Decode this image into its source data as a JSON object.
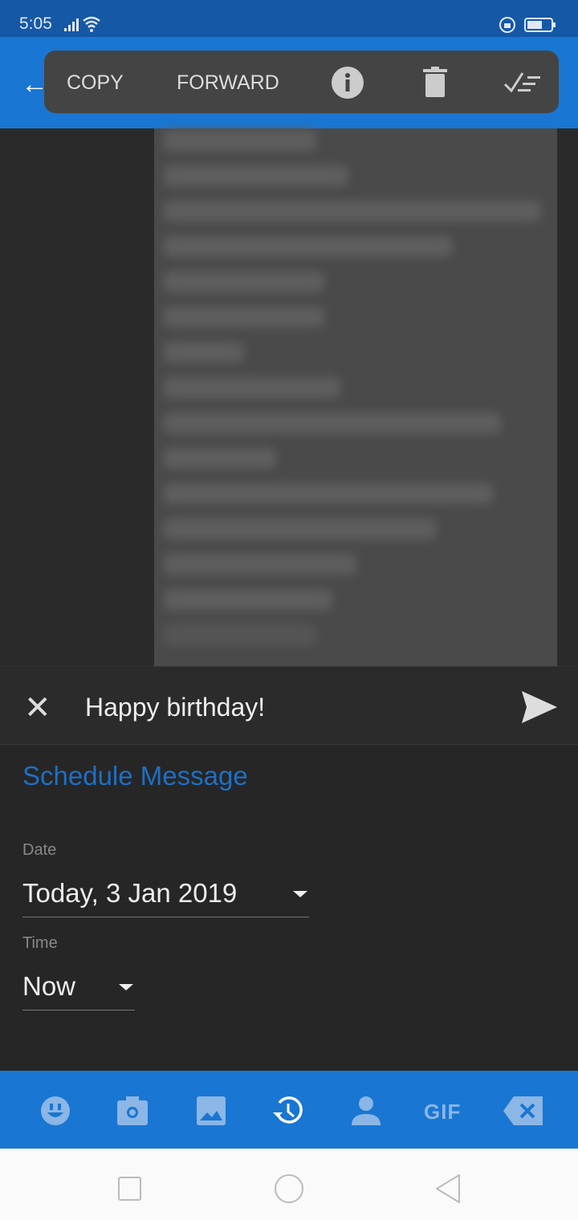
{
  "status_bar": {
    "time": "5:05",
    "icons": [
      "signal-icon",
      "wifi-icon",
      "lock-rotation-icon",
      "battery-icon"
    ]
  },
  "action_bar": {
    "copy_label": "COPY",
    "forward_label": "FORWARD",
    "icons": [
      "back-arrow-icon",
      "info-icon",
      "delete-icon",
      "select-all-icon"
    ]
  },
  "compose": {
    "text": "Happy birthday!"
  },
  "schedule": {
    "title": "Schedule Message",
    "date_label": "Date",
    "date_value": "Today, 3 Jan 2019",
    "time_label": "Time",
    "time_value": "Now"
  },
  "toolbar": {
    "gif_label": "GIF",
    "icons": [
      "emoji-icon",
      "camera-icon",
      "gallery-icon",
      "schedule-icon",
      "contact-icon",
      "gif-icon",
      "backspace-icon"
    ]
  },
  "colors": {
    "accent": "#1976d2",
    "status_bar": "#1558a6",
    "link": "#1e6fc4"
  }
}
